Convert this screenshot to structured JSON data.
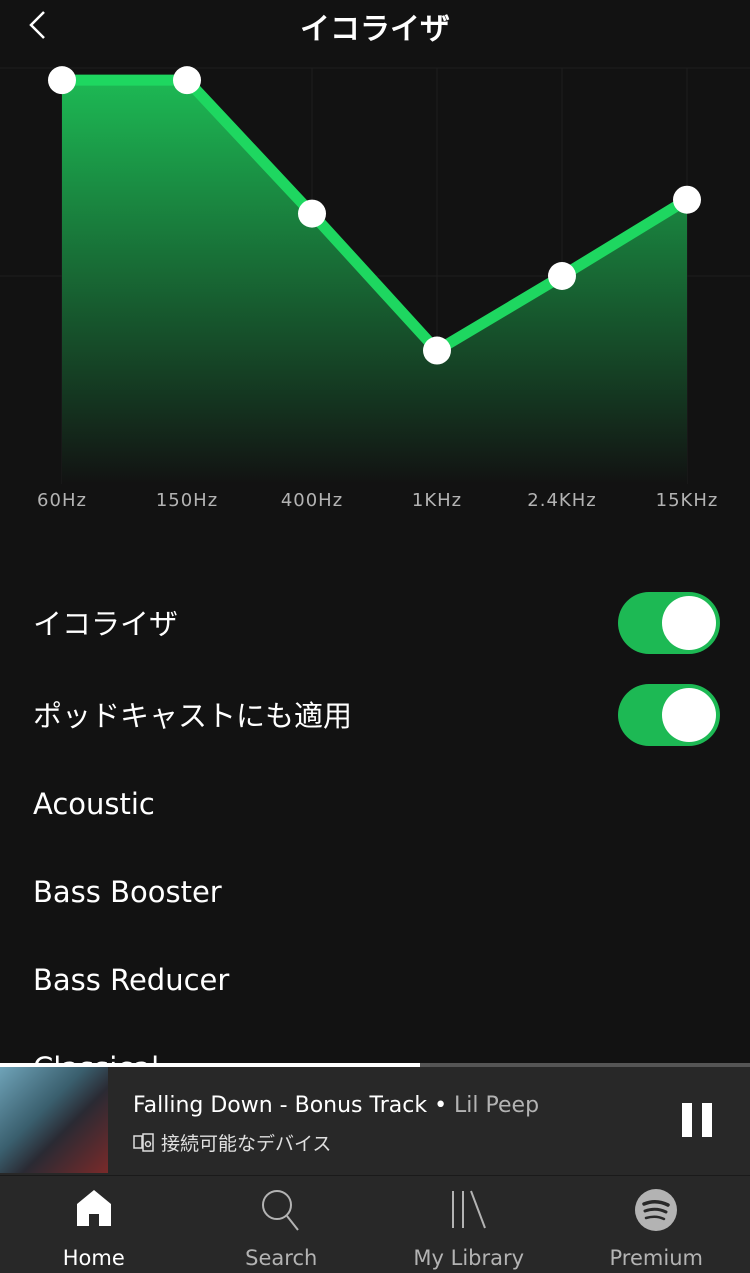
{
  "header": {
    "title": "イコライザ",
    "back_icon": "chevron-left-icon"
  },
  "chart_data": {
    "type": "area",
    "categories": [
      "60Hz",
      "150Hz",
      "400Hz",
      "1KHz",
      "2.4KHz",
      "15KHz"
    ],
    "values": [
      11.3,
      11.3,
      3.6,
      -4.3,
      0,
      4.4
    ],
    "ylim": [
      -12,
      12
    ],
    "grid": true,
    "colors": {
      "line": "#1ed760",
      "fill_top": "#1db954",
      "point": "#ffffff"
    }
  },
  "settings": {
    "equalizer": {
      "label": "イコライザ",
      "on": true
    },
    "podcast": {
      "label": "ポッドキャストにも適用",
      "on": true
    }
  },
  "presets": [
    "Acoustic",
    "Bass Booster",
    "Bass Reducer",
    "Classical"
  ],
  "player": {
    "track": "Falling Down - Bonus Track",
    "separator": " • ",
    "artist": "Lil Peep",
    "device": "接続可能なデバイス",
    "progress": 0.56
  },
  "nav": [
    {
      "label": "Home",
      "icon": "home-icon"
    },
    {
      "label": "Search",
      "icon": "search-icon"
    },
    {
      "label": "My Library",
      "icon": "library-icon"
    },
    {
      "label": "Premium",
      "icon": "spotify-icon"
    }
  ],
  "colors": {
    "accent": "#1db954",
    "background": "#121212",
    "bar": "#282828"
  }
}
